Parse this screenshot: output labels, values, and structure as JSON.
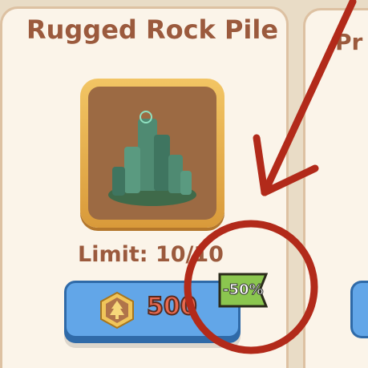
{
  "item_card": {
    "title": "Rugged Rock Pile",
    "limit_label": "Limit: 10/10",
    "price": "500",
    "discount_badge": "-50%",
    "currency_icon": "tree-coin-icon",
    "item_icon": "rock-pile-icon"
  },
  "next_card": {
    "title_partial": "Pr"
  },
  "annotation": {
    "color": "#b22a1a"
  }
}
